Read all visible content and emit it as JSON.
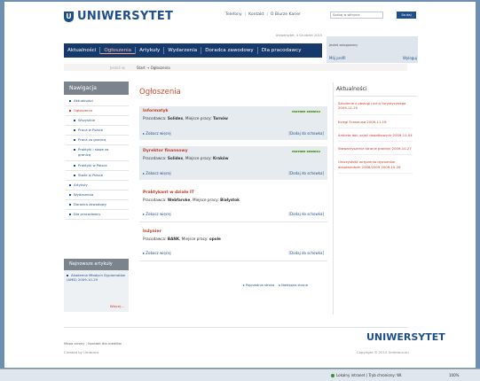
{
  "header": {
    "logo_text": "UNIWERSYTET",
    "logo_sub": "",
    "top_links": [
      "Telefony",
      "Kontakt",
      "O Biurze Karier"
    ],
    "date_line": "Uniwersytet, 4 Grudzien 2015"
  },
  "search": {
    "placeholder": "Szukaj w witrynie",
    "button": "Szukaj"
  },
  "user_panel": {
    "logged_in_text": "Jesteś zalogowany",
    "profile_link": "Mój profil",
    "logout_link": "Wyloguj"
  },
  "main_nav": [
    {
      "label": "Aktualności"
    },
    {
      "label": "Ogłoszenia"
    },
    {
      "label": "Artykuły"
    },
    {
      "label": "Wydarzenia"
    },
    {
      "label": "Doradca zawodowy"
    },
    {
      "label": "Dla pracodawcy"
    }
  ],
  "breadcrumb": {
    "where_label": "Jesteś w:",
    "trail": "Start → Ogłoszenia"
  },
  "sidebar": {
    "heading": "Nawigacja",
    "items": [
      {
        "label": "Aktualności"
      },
      {
        "label": "Ogłoszenia"
      },
      {
        "label": "Wszystkie"
      },
      {
        "label": "Praca w Polsce"
      },
      {
        "label": "Praca za granicą"
      },
      {
        "label": "Praktyki i staże za",
        "label2": "granicą"
      },
      {
        "label": "Praktyki w Polsce"
      },
      {
        "label": "Staże w Polsce"
      },
      {
        "label": "Artykuły"
      },
      {
        "label": "Wydarzenia"
      },
      {
        "label": "Doradca zawodowy"
      },
      {
        "label": "Dla pracodawcy"
      }
    ],
    "articles_heading": "Najnowsze artykuły",
    "article": "Akademia Młodych Dyplomatów (AMD) 2009-10-29",
    "more": "Więcej..."
  },
  "content": {
    "title": "Ogłoszenia",
    "partner_badge": "PARTNER SERWISU",
    "company_label": "Pracodawca:",
    "place_label": "Miejsce pracy:",
    "more_link": "Zobacz więcej",
    "add_link": "[Dodaj do schowka]",
    "announcements": [
      {
        "meta": "",
        "title": "Informatyk",
        "company": "Solidex",
        "place": "Tarnów"
      },
      {
        "meta": "",
        "title": "Dyrektor finansowy",
        "company": "Solidex",
        "place": "Kraków"
      },
      {
        "meta": "",
        "title": "Praktykant w dziale IT",
        "company": "Webfaroke",
        "place": "Białystok"
      },
      {
        "meta": "",
        "title": "Inżynier",
        "company": "BANK",
        "place": "opole"
      }
    ],
    "pager": [
      "Poprzednia strona",
      "Następna strona"
    ]
  },
  "news": {
    "heading": "Aktualności",
    "items": [
      "Szkolenie z obsługi ruchu turystycznego 2009-11-20",
      "Księgi Erasmusa 2009-11-16",
      "Ankieta dot. zajęć dodatkowych 2009-11-04",
      "Stowarzyszenie stronie praktyk 2009-10-27",
      "Uroczystość wręczenia dyplomów absolwentom 2008/2009 2009-10-26"
    ]
  },
  "footer": {
    "links": [
      "Mapa strony",
      "Kontakt dla mediów"
    ],
    "created": "Created by Umbraco",
    "logo": "UNIWERSYTET",
    "copyright": "Copyright © 2015 Umbraco.eu"
  },
  "statusbar": {
    "zone": "Lokalny intranet | Tryb chroniony: Wł.",
    "zoom": "100%"
  }
}
